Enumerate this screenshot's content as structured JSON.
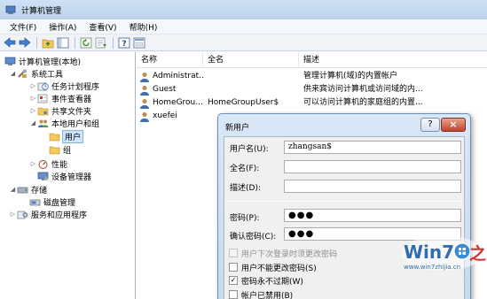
{
  "window": {
    "title": "计算机管理"
  },
  "menu": [
    "文件(F)",
    "操作(A)",
    "查看(V)",
    "帮助(H)"
  ],
  "tree": {
    "root": "计算机管理(本地)",
    "items": [
      {
        "label": "系统工具",
        "level": 1
      },
      {
        "label": "任务计划程序",
        "level": 2
      },
      {
        "label": "事件查看器",
        "level": 2
      },
      {
        "label": "共享文件夹",
        "level": 2
      },
      {
        "label": "本地用户和组",
        "level": 2
      },
      {
        "label": "用户",
        "level": 3,
        "selected": true
      },
      {
        "label": "组",
        "level": 3
      },
      {
        "label": "性能",
        "level": 2
      },
      {
        "label": "设备管理器",
        "level": 2
      },
      {
        "label": "存储",
        "level": 1
      },
      {
        "label": "磁盘管理",
        "level": 2
      },
      {
        "label": "服务和应用程序",
        "level": 1
      }
    ]
  },
  "list": {
    "columns": [
      "名称",
      "全名",
      "描述"
    ],
    "rows": [
      {
        "name": "Administrat...",
        "fullname": "",
        "desc": "管理计算机(域)的内置帐户"
      },
      {
        "name": "Guest",
        "fullname": "",
        "desc": "供来宾访问计算机或访问域的内..."
      },
      {
        "name": "HomeGrou...",
        "fullname": "HomeGroupUser$",
        "desc": "可以访问计算机的家庭组的内置..."
      },
      {
        "name": "xuefei",
        "fullname": "",
        "desc": ""
      }
    ]
  },
  "dialog": {
    "title": "新用户",
    "help": "?",
    "close": "×",
    "username_label": "用户名(U):",
    "username_value": "zhangsan$",
    "fullname_label": "全名(F):",
    "fullname_value": "",
    "desc_label": "描述(D):",
    "desc_value": "",
    "password_label": "密码(P):",
    "password_value": "●●●",
    "confirm_label": "确认密码(C):",
    "confirm_value": "●●●",
    "checkboxes": [
      {
        "label": "用户下次登录时须更改密码",
        "checked": false,
        "disabled": true
      },
      {
        "label": "用户不能更改密码(S)",
        "checked": false,
        "disabled": false
      },
      {
        "label": "密码永不过期(W)",
        "checked": true,
        "disabled": false
      },
      {
        "label": "帐户已禁用(B)",
        "checked": false,
        "disabled": false
      }
    ]
  },
  "watermark": {
    "brand": "Win7",
    "domain": "www.win7zhijia.cn",
    "suffix": "之家"
  }
}
